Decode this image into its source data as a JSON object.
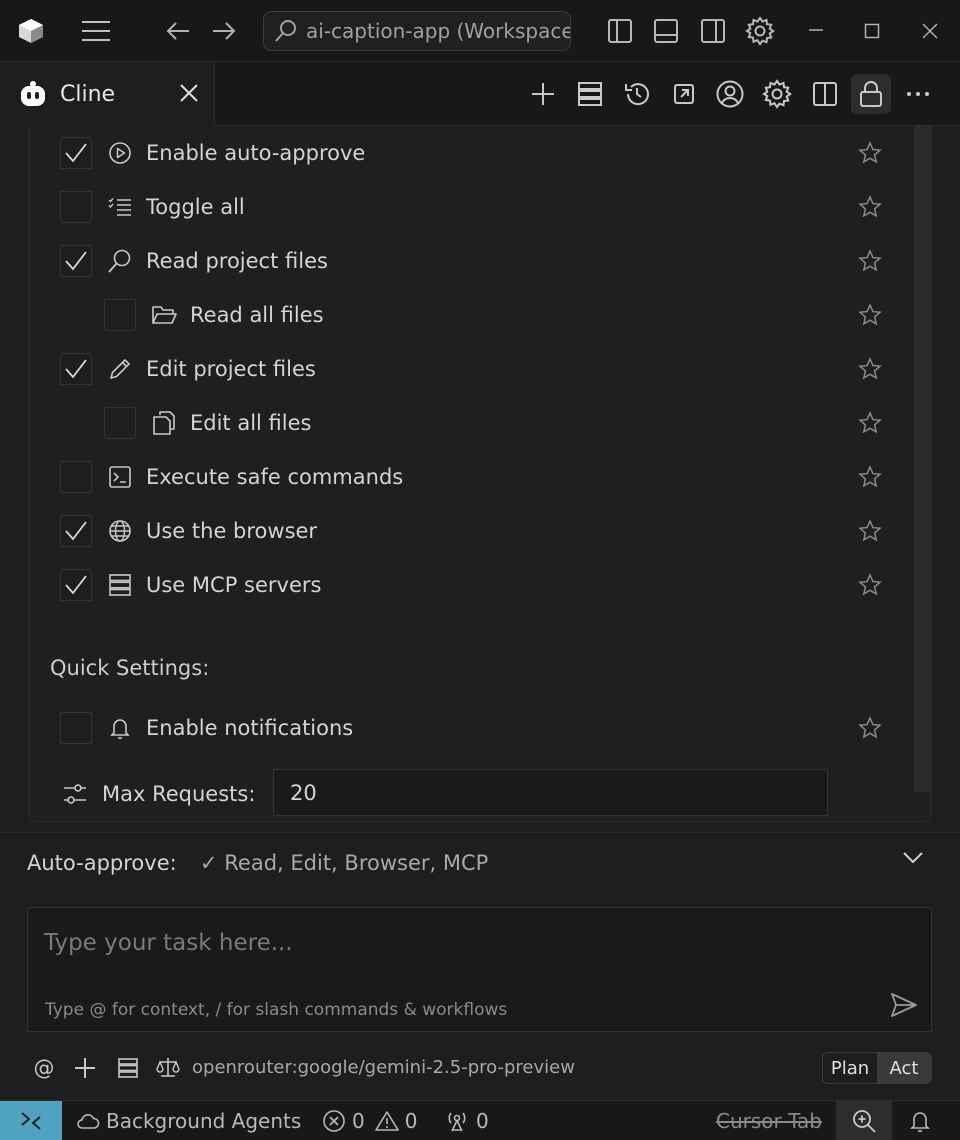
{
  "titlebar": {
    "search_text": "ai-caption-app (Workspace)"
  },
  "tab": {
    "label": "Cline"
  },
  "permissions": [
    {
      "label": "Enable auto-approve",
      "checked": true,
      "icon": "play-circle-icon",
      "indent": 0
    },
    {
      "label": "Toggle all",
      "checked": false,
      "icon": "checklist-icon",
      "indent": 0
    },
    {
      "label": "Read project files",
      "checked": true,
      "icon": "search-icon",
      "indent": 0
    },
    {
      "label": "Read all files",
      "checked": false,
      "icon": "folder-open-icon",
      "indent": 1
    },
    {
      "label": "Edit project files",
      "checked": true,
      "icon": "pencil-icon",
      "indent": 0
    },
    {
      "label": "Edit all files",
      "checked": false,
      "icon": "copy-files-icon",
      "indent": 1
    },
    {
      "label": "Execute safe commands",
      "checked": false,
      "icon": "terminal-icon",
      "indent": 0
    },
    {
      "label": "Use the browser",
      "checked": true,
      "icon": "globe-icon",
      "indent": 0
    },
    {
      "label": "Use MCP servers",
      "checked": true,
      "icon": "server-icon",
      "indent": 0
    }
  ],
  "quick_settings": {
    "title": "Quick Settings:",
    "notifications_label": "Enable notifications",
    "notifications_checked": false,
    "max_requests_label": "Max Requests:",
    "max_requests_value": "20"
  },
  "auto_approve": {
    "label": "Auto-approve:",
    "value": "✓ Read, Edit, Browser, MCP"
  },
  "task": {
    "placeholder": "Type your task here...",
    "hint": "Type @ for context, / for slash commands & workflows"
  },
  "toolbar": {
    "at_symbol": "@",
    "model": "openrouter:google/gemini-2.5-pro-preview",
    "plan_label": "Plan",
    "act_label": "Act",
    "active_mode": "Act"
  },
  "statusbar": {
    "background_agents": "Background Agents",
    "errors": "0",
    "warnings": "0",
    "ports": "0",
    "cursor_tab": "Cursor Tab"
  },
  "colors": {
    "background": "#1e1e1e",
    "remote_accent": "#4fa3c1"
  }
}
